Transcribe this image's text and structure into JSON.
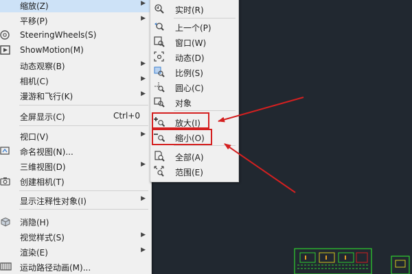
{
  "main_menu": {
    "items": [
      {
        "label": "缩放(Z)",
        "has_submenu": true,
        "highlighted": true
      },
      {
        "label": "平移(P)",
        "has_submenu": true
      },
      {
        "label": "SteeringWheels(S)"
      },
      {
        "label": "ShowMotion(M)"
      },
      {
        "label": "动态观察(B)",
        "has_submenu": true
      },
      {
        "label": "相机(C)",
        "has_submenu": true
      },
      {
        "label": "漫游和飞行(K)",
        "has_submenu": true
      },
      {
        "label": "全屏显示(C)",
        "shortcut": "Ctrl+0"
      },
      {
        "label": "视口(V)",
        "has_submenu": true
      },
      {
        "label": "命名视图(N)..."
      },
      {
        "label": "三维视图(D)",
        "has_submenu": true
      },
      {
        "label": "创建相机(T)"
      },
      {
        "label": "显示注释性对象(I)",
        "has_submenu": true
      },
      {
        "label": "消隐(H)"
      },
      {
        "label": "视觉样式(S)",
        "has_submenu": true
      },
      {
        "label": "渲染(E)",
        "has_submenu": true
      },
      {
        "label": "运动路径动画(M)..."
      }
    ]
  },
  "zoom_submenu": {
    "items": [
      {
        "label": "实时(R)",
        "icon": "zoom-realtime-icon"
      },
      {
        "label": "上一个(P)",
        "icon": "zoom-previous-icon"
      },
      {
        "label": "窗口(W)",
        "icon": "zoom-window-icon"
      },
      {
        "label": "动态(D)",
        "icon": "zoom-dynamic-icon"
      },
      {
        "label": "比例(S)",
        "icon": "zoom-scale-icon"
      },
      {
        "label": "圆心(C)",
        "icon": "zoom-center-icon"
      },
      {
        "label": "对象",
        "icon": "zoom-object-icon"
      },
      {
        "label": "放大(I)",
        "icon": "zoom-in-icon",
        "annotated": true
      },
      {
        "label": "缩小(O)",
        "icon": "zoom-out-icon",
        "annotated": true
      },
      {
        "label": "全部(A)",
        "icon": "zoom-all-icon"
      },
      {
        "label": "范围(E)",
        "icon": "zoom-extents-icon"
      }
    ]
  },
  "colors": {
    "canvas_bg": "#212830",
    "menu_bg": "#f0f0f0",
    "highlight": "#cde2f7",
    "annotation_red": "#d42020",
    "drawing_green": "#2fd12f"
  }
}
